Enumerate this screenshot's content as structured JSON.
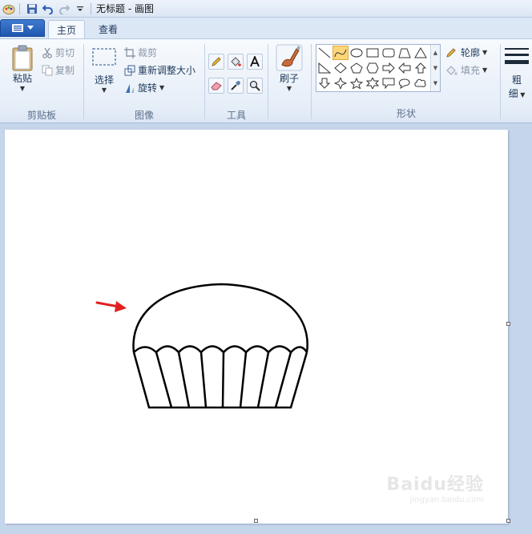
{
  "window": {
    "title": "无标题 - 画图"
  },
  "tabs": [
    {
      "label": "主页",
      "active": true
    },
    {
      "label": "查看",
      "active": false
    }
  ],
  "ribbon": {
    "clipboard": {
      "label": "剪贴板",
      "paste": "粘贴",
      "cut": "剪切",
      "copy": "复制"
    },
    "image": {
      "label": "图像",
      "select": "选择",
      "crop": "裁剪",
      "resize": "重新调整大小",
      "rotate": "旋转"
    },
    "tools": {
      "label": "工具",
      "items": [
        "pencil-icon",
        "fill-icon",
        "text-icon",
        "eraser-icon",
        "color-picker-icon",
        "magnifier-icon"
      ]
    },
    "brushes": {
      "label": "刷子"
    },
    "shapes": {
      "label": "形状",
      "outline": "轮廓",
      "fill": "填充",
      "selected": "curve"
    },
    "size": {
      "label_line1": "粗",
      "label_line2": "细"
    }
  },
  "canvas": {
    "background": "#ffffff",
    "arrow_color": "#e02020",
    "stroke_color": "#000000"
  },
  "watermark": {
    "main": "Baidu经验",
    "sub": "jingyan.baidu.com"
  }
}
